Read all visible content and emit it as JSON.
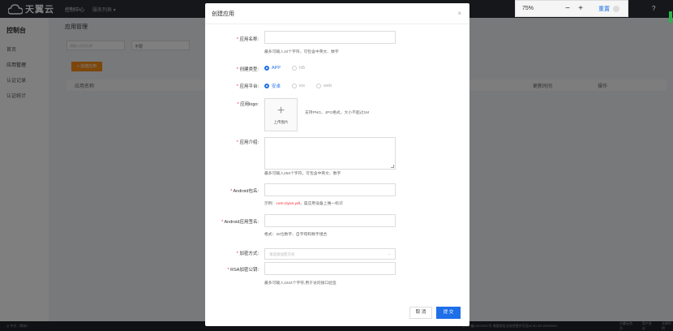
{
  "topbar": {
    "logo_text": "天翼云",
    "nav_console": "控制中心",
    "nav_service": "服务列表"
  },
  "zoom": {
    "value": "75%",
    "minus": "−",
    "plus": "+",
    "reset": "重置"
  },
  "help": "?",
  "sidebar": {
    "title": "控制台",
    "items": [
      {
        "label": "首页"
      },
      {
        "label": "应用管理"
      },
      {
        "label": "认证记录"
      },
      {
        "label": "认证统计"
      }
    ]
  },
  "page": {
    "title": "应用管理",
    "filter_placeholder": "请输入应用名称",
    "filter2_value": "不限",
    "create_button": "+ 创建应用",
    "columns": [
      "应用名称",
      "更新时间",
      "操作"
    ]
  },
  "modal": {
    "title": "创建应用",
    "close": "×",
    "fields": {
      "app_name": {
        "label": "应用名称:",
        "hint": "最多可输入10个字符，可包含中英文、数字"
      },
      "create_type": {
        "label": "创建类型:",
        "options": [
          "APP",
          "H5"
        ]
      },
      "platform": {
        "label": "应用平台:",
        "options": [
          "安卓",
          "ios",
          "web"
        ]
      },
      "logo": {
        "label": "应用logo:",
        "upload_label": "上传图片",
        "hint": "支持PNG、JPG格式，大小不超过1M"
      },
      "intro": {
        "label": "应用介绍:",
        "hint": "最多可输入256个字符，可包含中英文、数字"
      },
      "pkg": {
        "label": "Android包名:",
        "hint_prefix": "示例：",
        "hint_example": "com.ctyun.ydt",
        "hint_suffix": "，是应用设备上唯一标识"
      },
      "sign": {
        "label": "Android应用签名:",
        "hint": "格式：32位数字、自字母和数字组合"
      },
      "encrypt": {
        "label": "加密方式:",
        "placeholder": "请选择加密方式"
      },
      "rsa": {
        "label": "RSA加密公钥:",
        "hint": "最多可输入1024个字符,用于访问接口验签"
      }
    },
    "cancel": "取 消",
    "submit": "提 交"
  },
  "footer": {
    "lang": "中文（简体）",
    "icp": "京ICP备12022551号 增值电信业务经营许可证A2.B1.B2-20090001",
    "links": [
      "天翼云首页",
      "用户协议",
      "法律声明"
    ]
  },
  "colors": {
    "primary": "#1e6fe8",
    "orange": "#fa8c16",
    "required": "#f5222d",
    "topbar": "#2b2f36"
  }
}
